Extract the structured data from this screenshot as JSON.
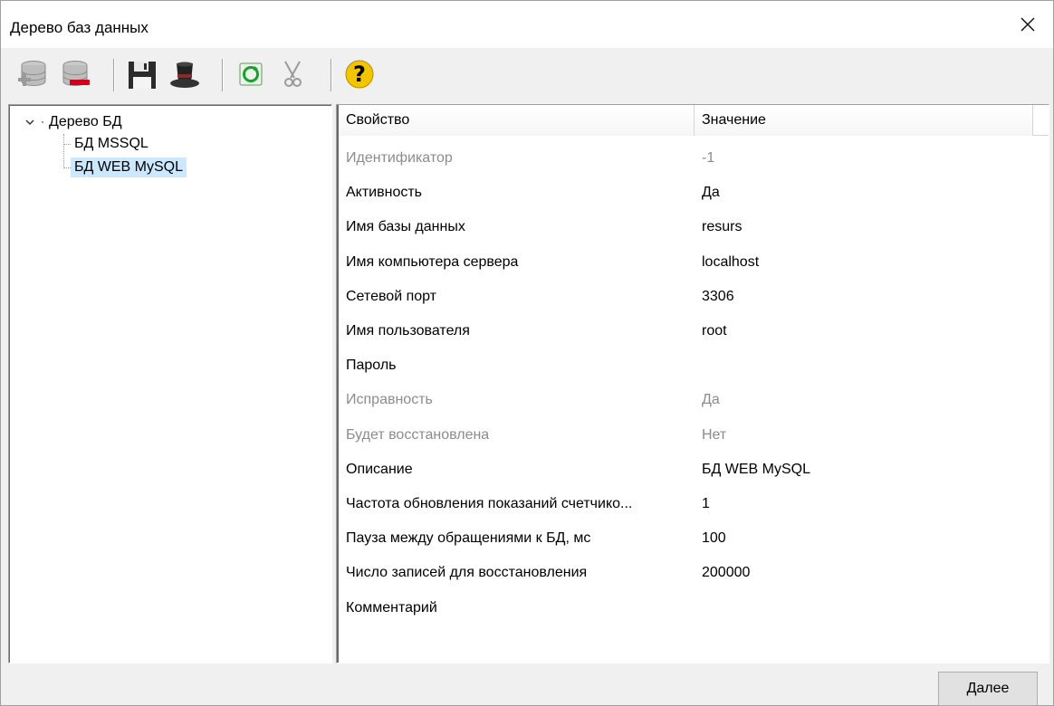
{
  "window": {
    "title": "Дерево баз данных"
  },
  "toolbar": {
    "buttons": [
      {
        "icon": "add-database-icon"
      },
      {
        "icon": "remove-database-icon"
      },
      {
        "icon": "save-icon"
      },
      {
        "icon": "magic-hat-icon"
      },
      {
        "icon": "refresh-icon"
      },
      {
        "icon": "scissors-icon"
      },
      {
        "icon": "help-icon"
      }
    ]
  },
  "tree": {
    "root_label": "Дерево БД",
    "children": [
      {
        "label": "БД MSSQL",
        "selected": false
      },
      {
        "label": "БД WEB MySQL",
        "selected": true
      }
    ]
  },
  "properties": {
    "col_property": "Свойство",
    "col_value": "Значение",
    "rows": [
      {
        "name": "Идентификатор",
        "value": "-1",
        "disabled": true
      },
      {
        "name": "Активность",
        "value": "Да",
        "disabled": false
      },
      {
        "name": "Имя базы данных",
        "value": "resurs",
        "disabled": false
      },
      {
        "name": "Имя компьютера сервера",
        "value": "localhost",
        "disabled": false
      },
      {
        "name": "Сетевой порт",
        "value": "3306",
        "disabled": false
      },
      {
        "name": "Имя пользователя",
        "value": "root",
        "disabled": false
      },
      {
        "name": "Пароль",
        "value": "",
        "disabled": false
      },
      {
        "name": "Исправность",
        "value": "Да",
        "disabled": true
      },
      {
        "name": "Будет восстановлена",
        "value": "Нет",
        "disabled": true
      },
      {
        "name": "Описание",
        "value": "БД WEB MySQL",
        "disabled": false
      },
      {
        "name": "Частота обновления показаний счетчико...",
        "value": "1",
        "disabled": false
      },
      {
        "name": "Пауза между обращениями к БД, мс",
        "value": "100",
        "disabled": false
      },
      {
        "name": "Число записей для восстановления",
        "value": "200000",
        "disabled": false
      },
      {
        "name": "Комментарий",
        "value": "",
        "disabled": false
      }
    ]
  },
  "footer": {
    "next_label": "Далее"
  },
  "colors": {
    "selection": "#cce8ff",
    "disabled_text": "#8c8c8c",
    "help_icon": "#f2c500"
  }
}
